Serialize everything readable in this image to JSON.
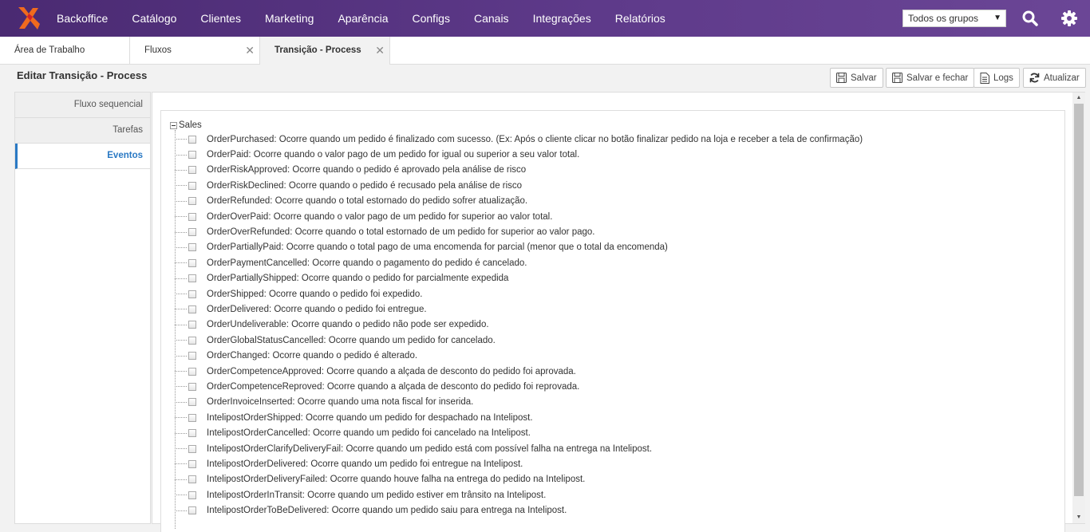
{
  "nav": {
    "items": [
      "Backoffice",
      "Catálogo",
      "Clientes",
      "Marketing",
      "Aparência",
      "Configs",
      "Canais",
      "Integrações",
      "Relatórios"
    ],
    "group_select": "Todos os grupos",
    "accent_color": "#5e3a8a"
  },
  "tabs": [
    {
      "label": "Área de Trabalho",
      "closable": false
    },
    {
      "label": "Fluxos",
      "closable": true
    },
    {
      "label": "Transição - Process",
      "closable": true,
      "active": true
    }
  ],
  "page": {
    "title": "Editar Transição - Process"
  },
  "toolbar": {
    "save_label": "Salvar",
    "save_close_label": "Salvar e fechar",
    "logs_label": "Logs",
    "refresh_label": "Atualizar"
  },
  "sidemenu": {
    "items": [
      {
        "label": "Fluxo sequencial"
      },
      {
        "label": "Tarefas"
      },
      {
        "label": "Eventos",
        "active": true
      }
    ]
  },
  "tree": {
    "root_label": "Sales",
    "items": [
      "OrderPurchased: Ocorre quando um pedido é finalizado com sucesso. (Ex: Após o cliente clicar no botão finalizar pedido na loja e receber a tela de confirmação)",
      "OrderPaid: Ocorre quando o valor pago de um pedido for igual ou superior a seu valor total.",
      "OrderRiskApproved: Ocorre quando o pedido é aprovado pela análise de risco",
      "OrderRiskDeclined: Ocorre quando o pedido é recusado pela análise de risco",
      "OrderRefunded: Ocorre quando o total estornado do pedido sofrer atualização.",
      "OrderOverPaid: Ocorre quando o valor pago de um pedido for superior ao valor total.",
      "OrderOverRefunded: Ocorre quando o total estornado de um pedido for superior ao valor pago.",
      "OrderPartiallyPaid: Ocorre quando o total pago de uma encomenda for parcial (menor que o total da encomenda)",
      "OrderPaymentCancelled: Ocorre quando o pagamento do pedido é cancelado.",
      "OrderPartiallyShipped: Ocorre quando o pedido for parcialmente expedida",
      "OrderShipped: Ocorre quando o pedido foi expedido.",
      "OrderDelivered: Ocorre quando o pedido foi entregue.",
      "OrderUndeliverable: Ocorre quando o pedido não pode ser expedido.",
      "OrderGlobalStatusCancelled: Ocorre quando um pedido for cancelado.",
      "OrderChanged: Ocorre quando o pedido é alterado.",
      "OrderCompetenceApproved: Ocorre quando a alçada de desconto do pedido foi aprovada.",
      "OrderCompetenceReproved: Ocorre quando a alçada de desconto do pedido foi reprovada.",
      "OrderInvoiceInserted: Ocorre quando uma nota fiscal for inserida.",
      "IntelipostOrderShipped: Ocorre quando um pedido for despachado na Intelipost.",
      "IntelipostOrderCancelled: Ocorre quando um pedido foi cancelado na Intelipost.",
      "IntelipostOrderClarifyDeliveryFail: Ocorre quando um pedido está com possível falha na entrega na Intelipost.",
      "IntelipostOrderDelivered: Ocorre quando um pedido foi entregue na Intelipost.",
      "IntelipostOrderDeliveryFailed: Ocorre quando houve falha na entrega do pedido na Intelipost.",
      "IntelipostOrderInTransit: Ocorre quando um pedido estiver em trânsito na Intelipost.",
      "IntelipostOrderToBeDelivered: Ocorre quando um pedido saiu para entrega na Intelipost."
    ]
  }
}
